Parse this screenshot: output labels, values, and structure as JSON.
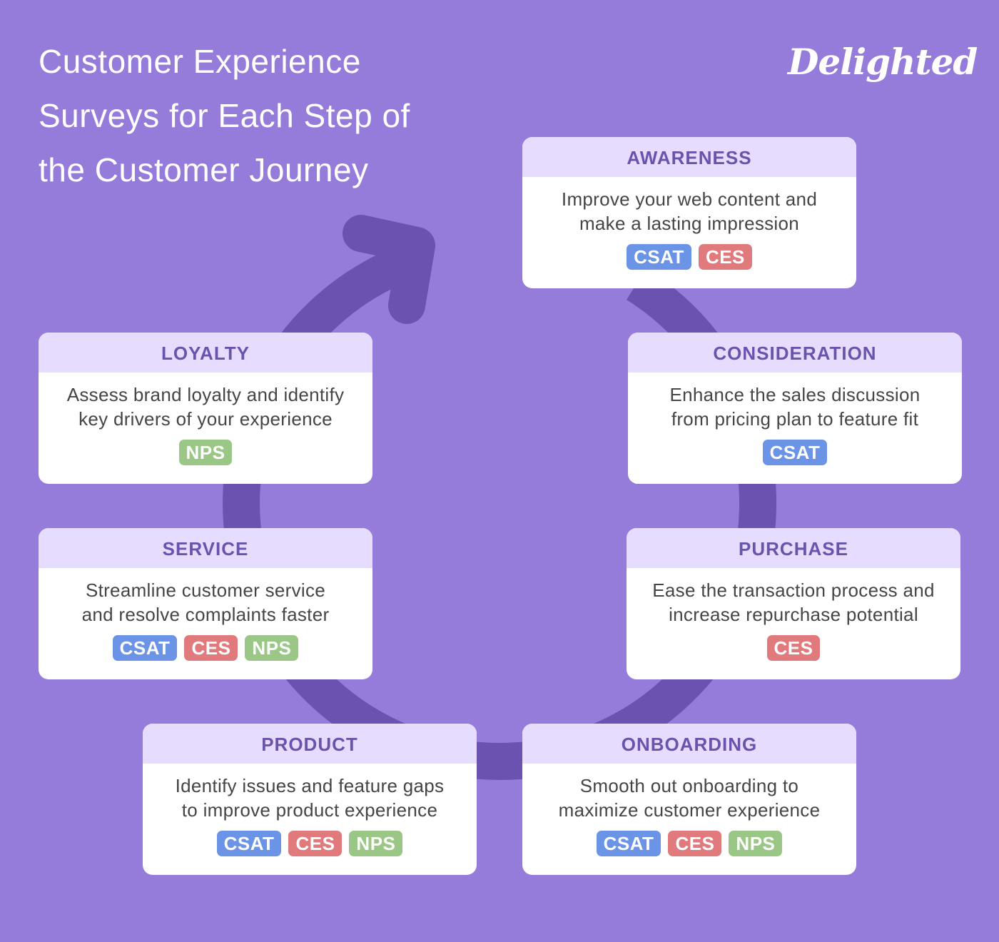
{
  "title": {
    "lines": [
      "Customer Experience",
      "Surveys for Each Step of",
      "the Customer Journey"
    ]
  },
  "logo": {
    "text": "Delighted"
  },
  "colors": {
    "background": "#967cda",
    "ring": "#6b52b0",
    "card_header": "#e6dcfd",
    "card_header_text": "#6a52ad",
    "body_text": "#454545",
    "CSAT": "#6b93e6",
    "CES": "#e07a7c",
    "NPS": "#9bc786"
  },
  "journey_icon": "circular-arrow-icon",
  "stages": [
    {
      "id": "awareness",
      "name": "AWARENESS",
      "description": [
        "Improve your web content and",
        "make a lasting impression"
      ],
      "surveys": [
        "CSAT",
        "CES"
      ]
    },
    {
      "id": "consideration",
      "name": "CONSIDERATION",
      "description": [
        "Enhance the sales discussion",
        "from pricing plan to feature fit"
      ],
      "surveys": [
        "CSAT"
      ]
    },
    {
      "id": "purchase",
      "name": "PURCHASE",
      "description": [
        "Ease the transaction process and",
        "increase repurchase potential"
      ],
      "surveys": [
        "CES"
      ]
    },
    {
      "id": "onboarding",
      "name": "ONBOARDING",
      "description": [
        "Smooth out onboarding to",
        "maximize customer experience"
      ],
      "surveys": [
        "CSAT",
        "CES",
        "NPS"
      ]
    },
    {
      "id": "product",
      "name": "PRODUCT",
      "description": [
        "Identify issues and feature gaps",
        "to improve product experience"
      ],
      "surveys": [
        "CSAT",
        "CES",
        "NPS"
      ]
    },
    {
      "id": "service",
      "name": "SERVICE",
      "description": [
        "Streamline customer service",
        "and resolve complaints faster"
      ],
      "surveys": [
        "CSAT",
        "CES",
        "NPS"
      ]
    },
    {
      "id": "loyalty",
      "name": "LOYALTY",
      "description": [
        "Assess brand loyalty and identify",
        "key drivers of your experience"
      ],
      "surveys": [
        "NPS"
      ]
    }
  ]
}
